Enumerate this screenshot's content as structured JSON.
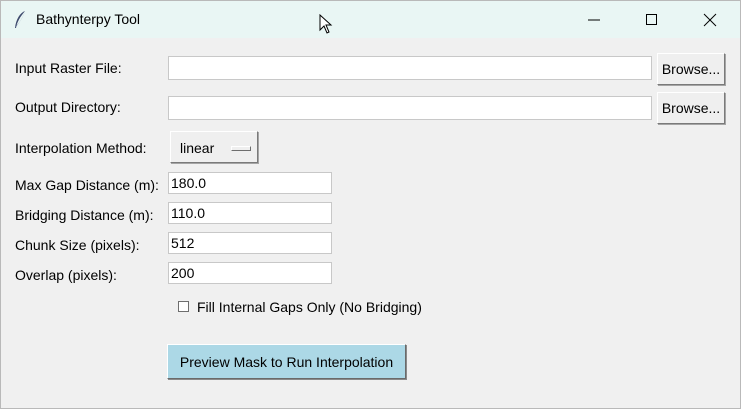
{
  "window": {
    "title": "Bathynterpy Tool",
    "icon": "feather-icon",
    "titlebar_color": "#e9f6f4"
  },
  "form": {
    "input_raster": {
      "label": "Input Raster File:",
      "value": "",
      "browse_label": "Browse..."
    },
    "output_dir": {
      "label": "Output Directory:",
      "value": "",
      "browse_label": "Browse..."
    },
    "interp_method": {
      "label": "Interpolation Method:",
      "value": "linear"
    },
    "max_gap": {
      "label": "Max Gap Distance (m):",
      "value": "180.0"
    },
    "bridging": {
      "label": "Bridging Distance (m):",
      "value": "110.0"
    },
    "chunk_size": {
      "label": "Chunk Size (pixels):",
      "value": "512"
    },
    "overlap": {
      "label": "Overlap (pixels):",
      "value": "200"
    },
    "fill_internal": {
      "label": "Fill Internal Gaps Only (No Bridging)",
      "checked": false
    },
    "run_button": {
      "label": "Preview Mask to Run Interpolation",
      "color": "#acd8e6"
    }
  }
}
